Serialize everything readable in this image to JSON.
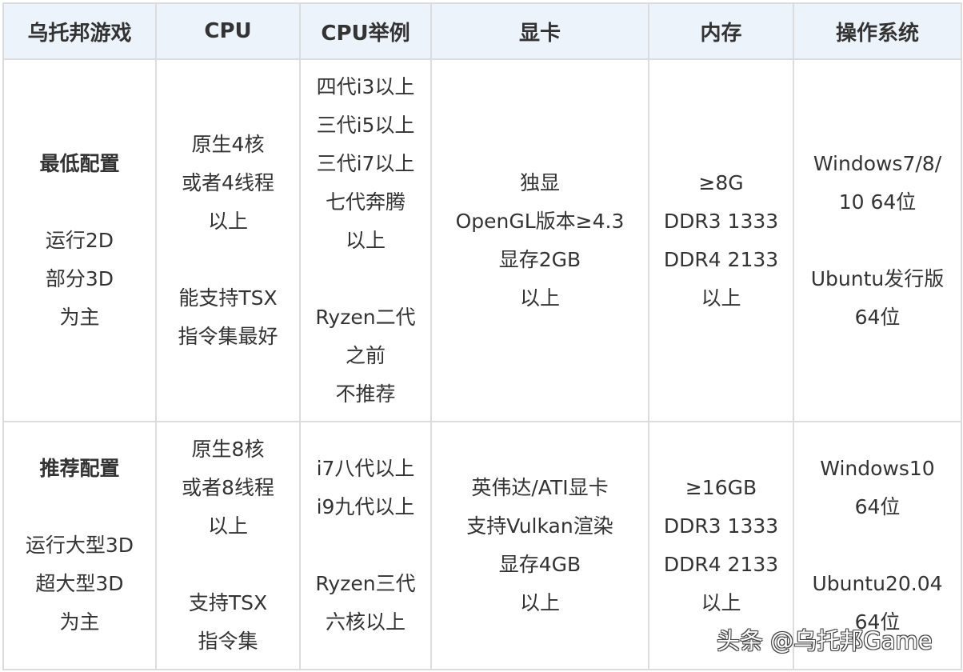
{
  "table": {
    "headers": [
      "乌托邦游戏",
      "CPU",
      "CPU举例",
      "显卡",
      "内存",
      "操作系统"
    ],
    "rows": [
      {
        "tier": {
          "title": "最低配置",
          "lines": [
            "运行2D",
            "部分3D",
            "为主"
          ]
        },
        "cpu": {
          "group1": [
            "原生4核",
            "或者4线程",
            "以上"
          ],
          "group2": [
            "能支持TSX",
            "指令集最好"
          ]
        },
        "cpu_examples": {
          "group1": [
            "四代i3以上",
            "三代i5以上",
            "三代i7以上",
            "七代奔腾",
            "以上"
          ],
          "group2": [
            "Ryzen二代",
            "之前",
            "不推荐"
          ]
        },
        "gpu": [
          "独显",
          "OpenGL版本≥4.3",
          "显存2GB",
          "以上"
        ],
        "memory": [
          "≥8G",
          "DDR3 1333",
          "DDR4 2133",
          "以上"
        ],
        "os": {
          "group1": [
            "Windows7/8/",
            "10 64位"
          ],
          "group2": [
            "Ubuntu发行版",
            "64位"
          ]
        }
      },
      {
        "tier": {
          "title": "推荐配置",
          "lines": [
            "运行大型3D",
            "超大型3D",
            "为主"
          ]
        },
        "cpu": {
          "group1": [
            "原生8核",
            "或者8线程",
            "以上"
          ],
          "group2": [
            "支持TSX",
            "指令集"
          ]
        },
        "cpu_examples": {
          "group1": [
            "i7八代以上",
            "i9九代以上"
          ],
          "group2": [
            "Ryzen三代",
            "六核以上"
          ]
        },
        "gpu": [
          "英伟达/ATI显卡",
          "支持Vulkan渲染",
          "显存4GB",
          "以上"
        ],
        "memory": [
          "≥16GB",
          "DDR3 1333",
          "DDR4 2133",
          "以上"
        ],
        "os": {
          "group1": [
            "Windows10",
            "64位"
          ],
          "group2": [
            "Ubuntu20.04",
            "64位"
          ]
        }
      }
    ]
  },
  "watermark": "头条 @乌托邦Game",
  "colors": {
    "header_bg": "#ecf3fb",
    "border": "#dcdcdc",
    "text": "#333333"
  }
}
